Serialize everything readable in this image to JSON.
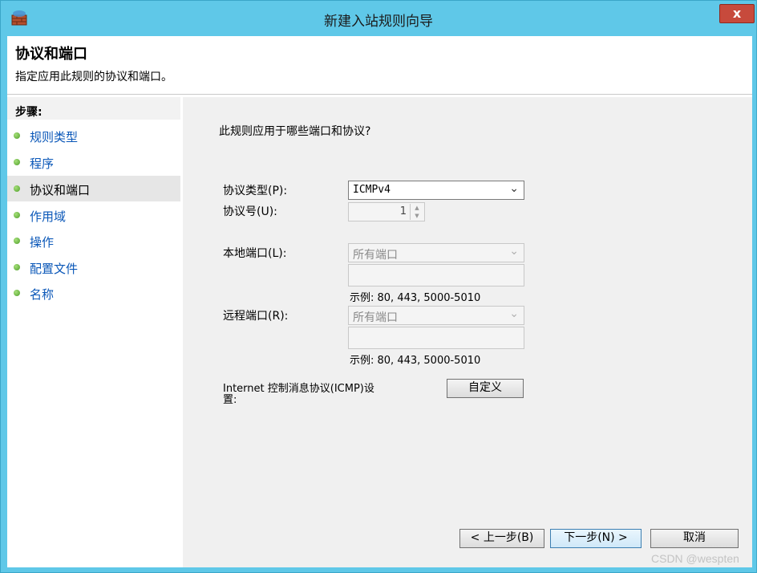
{
  "window": {
    "title": "新建入站规则向导",
    "close_label": "x",
    "app_icon": "firewall-icon"
  },
  "header": {
    "title": "协议和端口",
    "subtitle": "指定应用此规则的协议和端口。"
  },
  "steps": {
    "label": "步骤:",
    "items": [
      {
        "label": "规则类型",
        "active": false
      },
      {
        "label": "程序",
        "active": false
      },
      {
        "label": "协议和端口",
        "active": true
      },
      {
        "label": "作用域",
        "active": false
      },
      {
        "label": "操作",
        "active": false
      },
      {
        "label": "配置文件",
        "active": false
      },
      {
        "label": "名称",
        "active": false
      }
    ]
  },
  "main": {
    "question": "此规则应用于哪些端口和协议?",
    "protocol_type_label": "协议类型(P):",
    "protocol_type_value": "ICMPv4",
    "protocol_number_label": "协议号(U):",
    "protocol_number_value": "1",
    "local_port_label": "本地端口(L):",
    "local_port_value": "所有端口",
    "local_port_example": "示例: 80, 443, 5000-5010",
    "remote_port_label": "远程端口(R):",
    "remote_port_value": "所有端口",
    "remote_port_example": "示例: 80, 443, 5000-5010",
    "icmp_label_line1": "Internet 控制消息协议(ICMP)设",
    "icmp_label_line2": "置:",
    "customize_label": "自定义"
  },
  "footer": {
    "back_label": "< 上一步(B)",
    "next_label": "下一步(N) >",
    "cancel_label": "取消"
  },
  "watermark": "CSDN @wespten",
  "colors": {
    "title_bar": "#5fc8e8",
    "step_link": "#0a57b8",
    "bullet": "#5aae30",
    "close_button": "#c74a3c"
  }
}
